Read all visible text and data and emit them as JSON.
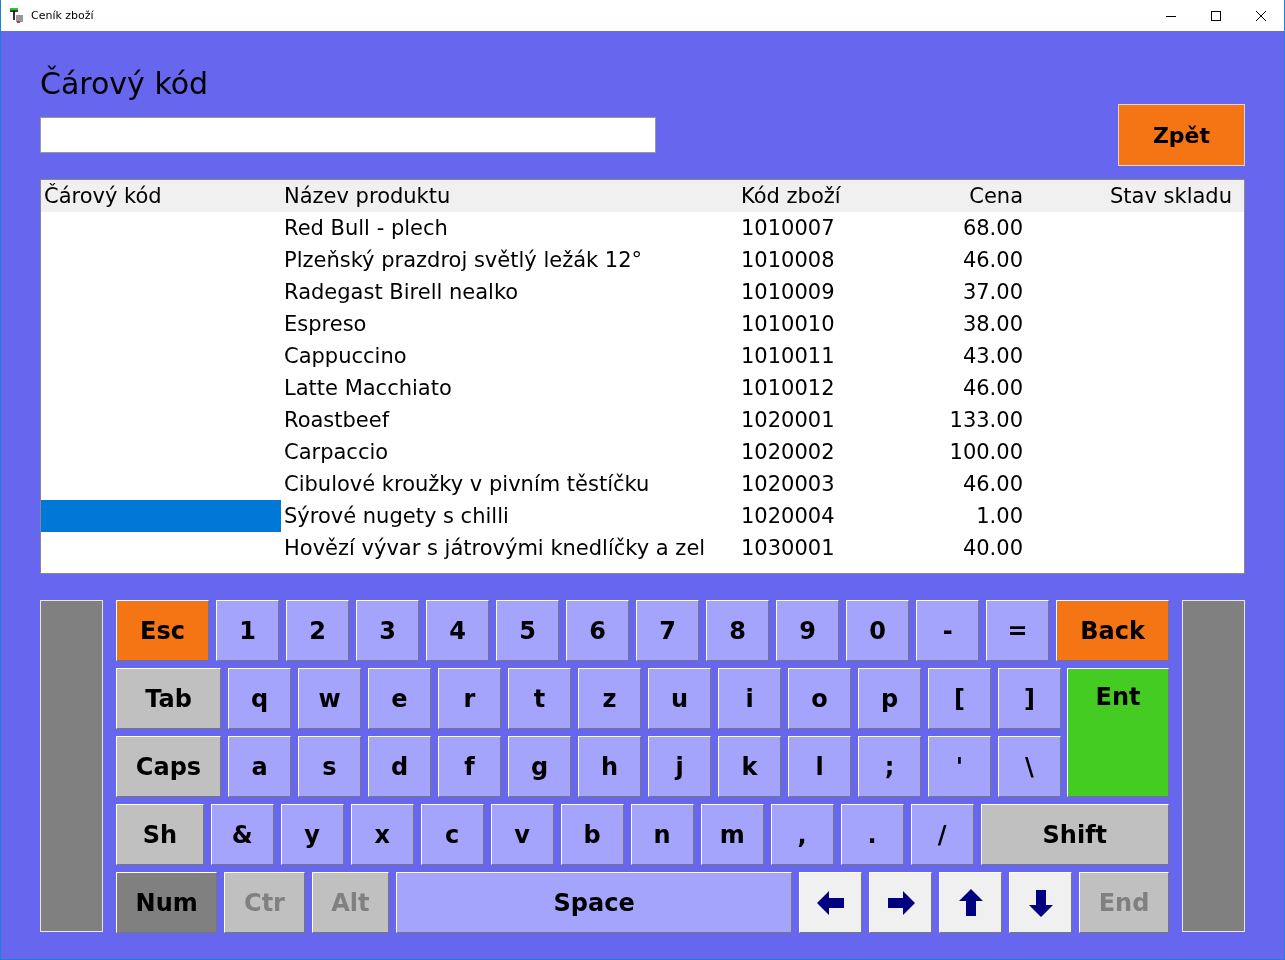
{
  "window": {
    "title": "Ceník zboží"
  },
  "barcode": {
    "label": "Čárový kód"
  },
  "back_button": {
    "label": "Zpět"
  },
  "table": {
    "columns": [
      "Čárový kód",
      "Název produktu",
      "Kód zboží",
      "Cena",
      "Stav skladu"
    ],
    "rows": [
      {
        "name": "Red Bull - plech",
        "code": "1010007",
        "price": "68.00",
        "selected": false
      },
      {
        "name": "Plzeňský prazdroj světlý ležák 12°",
        "code": "1010008",
        "price": "46.00",
        "selected": false
      },
      {
        "name": "Radegast Birell nealko",
        "code": "1010009",
        "price": "37.00",
        "selected": false
      },
      {
        "name": "Espreso",
        "code": "1010010",
        "price": "38.00",
        "selected": false
      },
      {
        "name": "Cappuccino",
        "code": "1010011",
        "price": "43.00",
        "selected": false
      },
      {
        "name": "Latte Macchiato",
        "code": "1010012",
        "price": "46.00",
        "selected": false
      },
      {
        "name": "Roastbeef",
        "code": "1020001",
        "price": "133.00",
        "selected": false
      },
      {
        "name": "Carpaccio",
        "code": "1020002",
        "price": "100.00",
        "selected": false
      },
      {
        "name": "Cibulové kroužky v pivním těstíčku",
        "code": "1020003",
        "price": "46.00",
        "selected": false
      },
      {
        "name": "Sýrové nugety s chilli",
        "code": "1020004",
        "price": "1.00",
        "selected": true
      },
      {
        "name": "Hovězí vývar s játrovými knedlíčky a zel",
        "code": "1030001",
        "price": "40.00",
        "selected": false
      }
    ]
  },
  "keyboard": {
    "rows": [
      {
        "keys": [
          {
            "label": "Esc",
            "kind": "action",
            "disabled": false
          },
          {
            "label": "1",
            "kind": "char",
            "disabled": false
          },
          {
            "label": "2",
            "kind": "char",
            "disabled": false
          },
          {
            "label": "3",
            "kind": "char",
            "disabled": false
          },
          {
            "label": "4",
            "kind": "char",
            "disabled": false
          },
          {
            "label": "5",
            "kind": "char",
            "disabled": false
          },
          {
            "label": "6",
            "kind": "char",
            "disabled": false
          },
          {
            "label": "7",
            "kind": "char",
            "disabled": false
          },
          {
            "label": "8",
            "kind": "char",
            "disabled": false
          },
          {
            "label": "9",
            "kind": "char",
            "disabled": false
          },
          {
            "label": "0",
            "kind": "char",
            "disabled": false
          },
          {
            "label": "-",
            "kind": "char",
            "disabled": false
          },
          {
            "label": "=",
            "kind": "char",
            "disabled": false
          },
          {
            "label": "Back",
            "kind": "action",
            "disabled": false
          }
        ]
      },
      {
        "keys": [
          {
            "label": "Tab",
            "kind": "mod",
            "disabled": false
          },
          {
            "label": "q",
            "kind": "char",
            "disabled": false
          },
          {
            "label": "w",
            "kind": "char",
            "disabled": false
          },
          {
            "label": "e",
            "kind": "char",
            "disabled": false
          },
          {
            "label": "r",
            "kind": "char",
            "disabled": false
          },
          {
            "label": "t",
            "kind": "char",
            "disabled": false
          },
          {
            "label": "z",
            "kind": "char",
            "disabled": false
          },
          {
            "label": "u",
            "kind": "char",
            "disabled": false
          },
          {
            "label": "i",
            "kind": "char",
            "disabled": false
          },
          {
            "label": "o",
            "kind": "char",
            "disabled": false
          },
          {
            "label": "p",
            "kind": "char",
            "disabled": false
          },
          {
            "label": "[",
            "kind": "char",
            "disabled": false
          },
          {
            "label": "]",
            "kind": "char",
            "disabled": false
          },
          {
            "label": "Ent",
            "kind": "enter",
            "disabled": false
          }
        ]
      },
      {
        "keys": [
          {
            "label": "Caps",
            "kind": "mod",
            "disabled": false
          },
          {
            "label": "a",
            "kind": "char",
            "disabled": false
          },
          {
            "label": "s",
            "kind": "char",
            "disabled": false
          },
          {
            "label": "d",
            "kind": "char",
            "disabled": false
          },
          {
            "label": "f",
            "kind": "char",
            "disabled": false
          },
          {
            "label": "g",
            "kind": "char",
            "disabled": false
          },
          {
            "label": "h",
            "kind": "char",
            "disabled": false
          },
          {
            "label": "j",
            "kind": "char",
            "disabled": false
          },
          {
            "label": "k",
            "kind": "char",
            "disabled": false
          },
          {
            "label": "l",
            "kind": "char",
            "disabled": false
          },
          {
            "label": ";",
            "kind": "char",
            "disabled": false
          },
          {
            "label": "'",
            "kind": "char",
            "disabled": false
          },
          {
            "label": "\\",
            "kind": "char",
            "disabled": false
          }
        ]
      },
      {
        "keys": [
          {
            "label": "Sh",
            "kind": "mod",
            "disabled": false
          },
          {
            "label": "&",
            "kind": "char",
            "disabled": false
          },
          {
            "label": "y",
            "kind": "char",
            "disabled": false
          },
          {
            "label": "x",
            "kind": "char",
            "disabled": false
          },
          {
            "label": "c",
            "kind": "char",
            "disabled": false
          },
          {
            "label": "v",
            "kind": "char",
            "disabled": false
          },
          {
            "label": "b",
            "kind": "char",
            "disabled": false
          },
          {
            "label": "n",
            "kind": "char",
            "disabled": false
          },
          {
            "label": "m",
            "kind": "char",
            "disabled": false
          },
          {
            "label": ",",
            "kind": "char",
            "disabled": false
          },
          {
            "label": ".",
            "kind": "char",
            "disabled": false
          },
          {
            "label": "/",
            "kind": "char",
            "disabled": false
          },
          {
            "label": "Shift",
            "kind": "wide",
            "disabled": false
          }
        ]
      },
      {
        "keys": [
          {
            "label": "Num",
            "kind": "toggle",
            "disabled": false
          },
          {
            "label": "Ctr",
            "kind": "mod",
            "disabled": true
          },
          {
            "label": "Alt",
            "kind": "mod",
            "disabled": true
          },
          {
            "label": "Space",
            "kind": "space",
            "disabled": false
          },
          {
            "kind": "left",
            "disabled": false
          },
          {
            "kind": "right",
            "disabled": false
          },
          {
            "kind": "up",
            "disabled": false
          },
          {
            "kind": "down",
            "disabled": false
          },
          {
            "label": "End",
            "kind": "mod",
            "disabled": true
          }
        ]
      }
    ]
  }
}
